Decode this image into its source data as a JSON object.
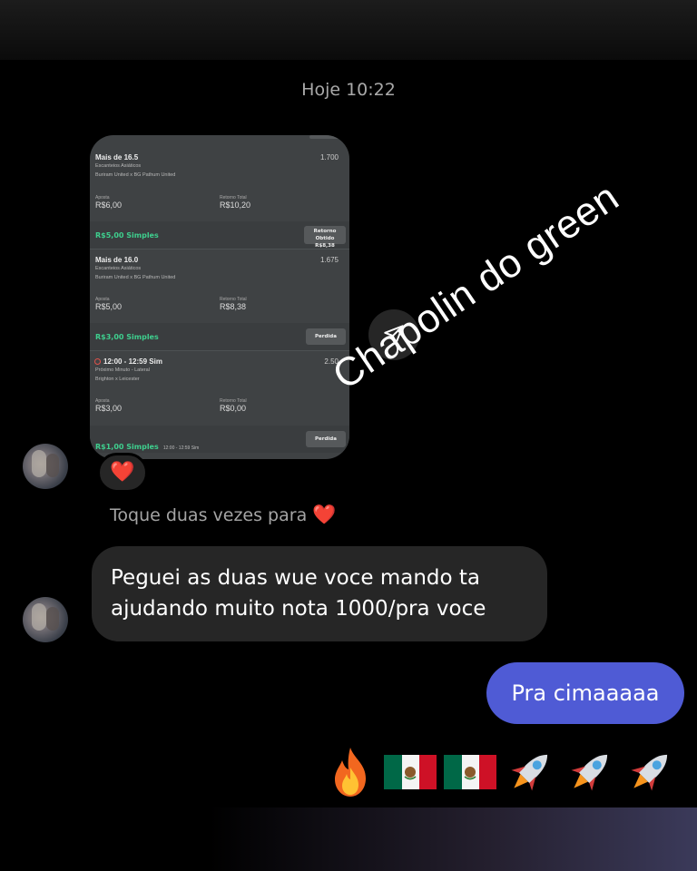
{
  "header": {
    "timestamp": "Hoje 10:22"
  },
  "shared_screenshot": {
    "bets": [
      {
        "title": "Mais de 16.5",
        "odd": "1.700",
        "market": "Escanteios Asiáticos",
        "match": "Buriram United x BG Pathum United",
        "stake_label": "Aposta",
        "stake": "R$6,00",
        "return_label": "Retorno Total",
        "return": "R$10,20"
      },
      {
        "title": "Mais de 16.0",
        "odd": "1.675",
        "market": "Escanteios Asiáticos",
        "match": "Buriram United x BG Pathum United",
        "stake_label": "Aposta",
        "stake": "R$5,00",
        "return_label": "Retorno Total",
        "return": "R$8,38"
      },
      {
        "title": "12:00 - 12:59 Sim",
        "odd": "2.50",
        "market": "Próximo Minuto - Lateral",
        "match": "Brighton x Leicester",
        "stake_label": "Aposta",
        "stake": "R$3,00",
        "return_label": "Retorno Total",
        "return": "R$0,00"
      }
    ],
    "strips": [
      {
        "label": "R$5,00 Simples",
        "button": "Retorno Obtido",
        "button_value": "R$8,38"
      },
      {
        "label": "R$3,00 Simples",
        "button": "Perdida"
      },
      {
        "label": "R$1,00 Simples",
        "sub": "12:00 - 12:59 Sim",
        "button": "Perdida"
      }
    ]
  },
  "sticker_text": "Chapolin do green",
  "reaction": "❤️",
  "hint": {
    "text": "Toque duas vezes para",
    "emoji": "❤️"
  },
  "incoming_message": "Peguei as duas wue voce mando ta ajudando muito nota 1000/pra voce",
  "outgoing_message": "Pra cimaaaaa",
  "emoji_reply": [
    "fire",
    "mexico-flag",
    "mexico-flag",
    "rocket",
    "rocket",
    "rocket"
  ],
  "colors": {
    "bubble_out": "#4f5bd5",
    "bubble_in": "#262626",
    "green": "#3ecf8e"
  }
}
